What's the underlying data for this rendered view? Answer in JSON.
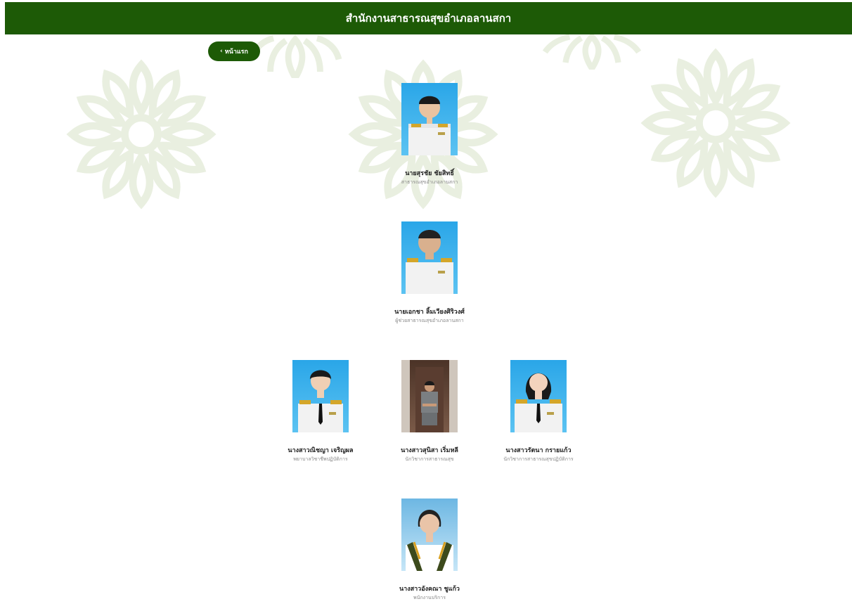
{
  "header": {
    "title": "สำนักงานสาธารณสุขอำเภอลานสกา"
  },
  "nav": {
    "back_label": "หน้าแรก"
  },
  "colors": {
    "brand_green": "#1d5a06",
    "lotus_tint": "#e9efe0"
  },
  "staff": [
    {
      "name": "นายสุรชัย ชัยสิทธิ์",
      "title": "สาธารณสุขอำเภอลานสกา"
    },
    {
      "name": "นายเอกชา ลิ้มเวียงศิริวงศ์",
      "title": "ผู้ช่วยสาธารณสุขอำเภอลานสกา"
    },
    {
      "name": "นางสาวณิชญา เจริญผล",
      "title": "พยาบาลวิชาชีพปฏิบัติการ"
    },
    {
      "name": "นางสาวสุนิสา เริ่มหลี",
      "title": "นักวิชาการสาธารณสุข"
    },
    {
      "name": "นางสาวรัตนา กรายแก้ว",
      "title": "นักวิชาการสาธารณสุขปฏิบัติการ"
    },
    {
      "name": "นางสาวอังคณา ชูแก้ว",
      "title": "พนักงานบริการ"
    }
  ]
}
